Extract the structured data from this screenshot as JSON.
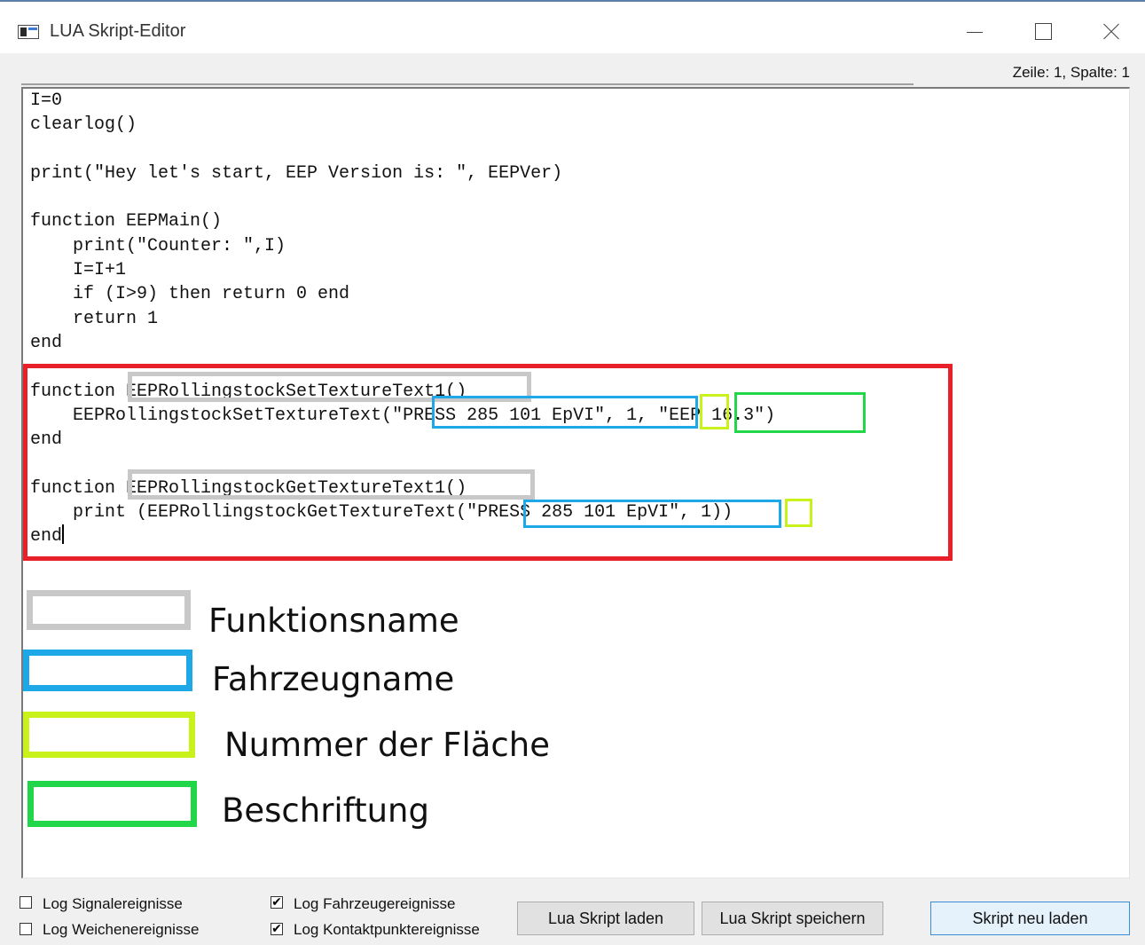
{
  "window": {
    "title": "LUA Skript-Editor"
  },
  "status": {
    "position": "Zeile: 1, Spalte: 1"
  },
  "code": {
    "lines": [
      "I=0",
      "clearlog()",
      "",
      "print(\"Hey let's start, EEP Version is: \", EEPVer)",
      "",
      "function EEPMain()",
      "    print(\"Counter: \",I)",
      "    I=I+1",
      "    if (I>9) then return 0 end",
      "    return 1",
      "end",
      "",
      "function EEPRollingstockSetTextureText1()",
      "    EEPRollingstockSetTextureText(\"PRESS 285 101 EpVI\", 1, \"EEP 16.3\")",
      "end",
      "",
      "function EEPRollingstockGetTextureText1()",
      "    print (EEPRollingstockGetTextureText(\"PRESS 285 101 EpVI\", 1))",
      "end"
    ]
  },
  "legend": {
    "items": [
      {
        "label": "Funktionsname",
        "color": "#c8c8c8"
      },
      {
        "label": "Fahrzeugname",
        "color": "#1ea8e8"
      },
      {
        "label": "Nummer der Fläche",
        "color": "#c8f21a"
      },
      {
        "label": "Beschriftung",
        "color": "#22d64a"
      }
    ]
  },
  "options": {
    "log_signal": {
      "label": "Log Signalereignisse",
      "checked": false
    },
    "log_switch": {
      "label": "Log Weichenereignisse",
      "checked": false
    },
    "log_vehicle": {
      "label": "Log Fahrzeugereignisse",
      "checked": true
    },
    "log_contact": {
      "label": "Log Kontaktpunktereignisse",
      "checked": true
    }
  },
  "buttons": {
    "load": "Lua Skript laden",
    "save": "Lua Skript speichern",
    "reload": "Skript neu laden"
  }
}
